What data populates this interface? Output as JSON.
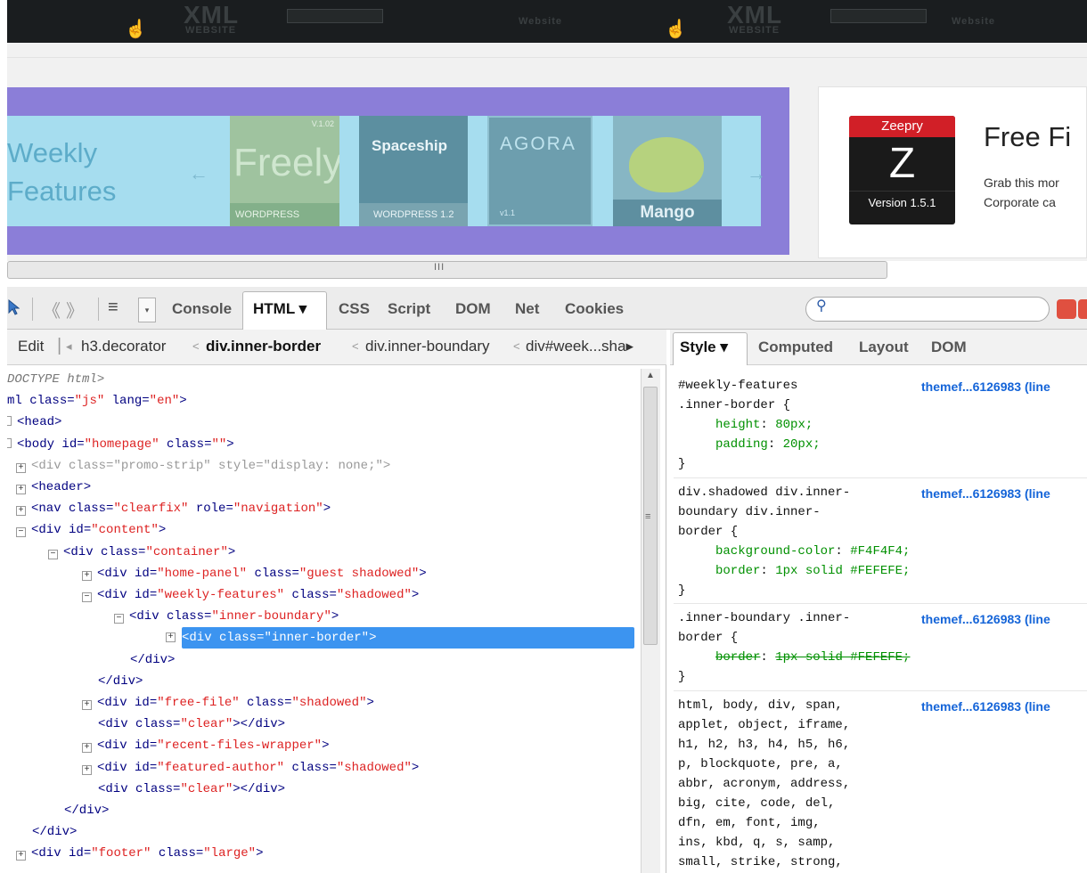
{
  "banner": {
    "items": [
      "XML",
      "WEBSITE",
      "XML",
      "WEBSITE"
    ],
    "small": [
      "Website",
      "Website"
    ]
  },
  "weekly": {
    "title_line1": "Weekly",
    "title_line2": "Features",
    "themes": [
      {
        "name": "Freely",
        "version": "V.1.02",
        "label": "WORDPRESS"
      },
      {
        "name": "Spaceship",
        "label": "WORDPRESS 1.2"
      },
      {
        "name": "AGORA",
        "label": "v1.1"
      },
      {
        "name": "Mango",
        "label": "Mango"
      }
    ]
  },
  "free_file": {
    "brand": "Zeepry",
    "logo_letter": "Z",
    "version": "Version 1.5.1",
    "title": "Free Fi",
    "desc_line1": "Grab this mor",
    "desc_line2": "Corporate ca"
  },
  "scrollbar": {
    "grip": "III"
  },
  "toolbar": {
    "tabs": [
      "Console",
      "HTML ▾",
      "CSS",
      "Script",
      "DOM",
      "Net",
      "Cookies"
    ],
    "search_placeholder": ""
  },
  "breadcrumb": {
    "edit": "Edit",
    "items": [
      "h3.decorator",
      "div.inner-border",
      "div.inner-boundary",
      "div#week...sha▸"
    ]
  },
  "dom_tree": [
    {
      "indent": 0,
      "exp": "",
      "text": "DOCTYPE html>",
      "kind": "doctype"
    },
    {
      "indent": 0,
      "exp": "",
      "pre": "ml ",
      "attr": "class=",
      "val": "\"js\"",
      "post": " lang=",
      "val2": "\"en\"",
      "end": ">",
      "kind": "html"
    },
    {
      "indent": 0,
      "exp": "-",
      "tag": "<head>",
      "kind": "tag"
    },
    {
      "indent": 0,
      "exp": "-",
      "tag": "<body ",
      "attr": "id=",
      "val": "\"homepage\"",
      "post": " class=",
      "val2": "\"\"",
      "end": ">",
      "kind": "attr"
    },
    {
      "indent": 1,
      "exp": "+",
      "tag": "<div ",
      "attr": "class=",
      "val": "\"promo-strip\"",
      "post": " style=",
      "val2": "\"display: none;\"",
      "end": ">",
      "kind": "attr",
      "dim": true
    },
    {
      "indent": 1,
      "exp": "+",
      "tag": "<header>",
      "kind": "tag"
    },
    {
      "indent": 1,
      "exp": "+",
      "tag": "<nav ",
      "attr": "class=",
      "val": "\"clearfix\"",
      "post": " role=",
      "val2": "\"navigation\"",
      "end": ">",
      "kind": "attr"
    },
    {
      "indent": 1,
      "exp": "-",
      "tag": "<div ",
      "attr": "id=",
      "val": "\"content\"",
      "end": ">",
      "kind": "attr"
    },
    {
      "indent": 2,
      "exp": "-",
      "tag": "<div ",
      "attr": "class=",
      "val": "\"container\"",
      "end": ">",
      "kind": "attr"
    },
    {
      "indent": 3,
      "exp": "+",
      "tag": "<div ",
      "attr": "id=",
      "val": "\"home-panel\"",
      "post": " class=",
      "val2": "\"guest shadowed\"",
      "end": ">",
      "kind": "attr"
    },
    {
      "indent": 3,
      "exp": "-",
      "tag": "<div ",
      "attr": "id=",
      "val": "\"weekly-features\"",
      "post": " class=",
      "val2": "\"shadowed\"",
      "end": ">",
      "kind": "attr"
    },
    {
      "indent": 4,
      "exp": "-",
      "tag": "<div ",
      "attr": "class=",
      "val": "\"inner-boundary\"",
      "end": ">",
      "kind": "attr"
    },
    {
      "indent": 5,
      "exp": "+",
      "tag": "<div ",
      "attr": "class=",
      "val": "\"inner-border\"",
      "end": ">",
      "kind": "attr",
      "selected": true
    },
    {
      "indent": 4,
      "exp": "",
      "tag": "</div>",
      "kind": "tag",
      "pad": true
    },
    {
      "indent": 3,
      "exp": "",
      "tag": "</div>",
      "kind": "tag",
      "pad": true
    },
    {
      "indent": 3,
      "exp": "+",
      "tag": "<div ",
      "attr": "id=",
      "val": "\"free-file\"",
      "post": " class=",
      "val2": "\"shadowed\"",
      "end": ">",
      "kind": "attr"
    },
    {
      "indent": 3,
      "exp": "",
      "tag": "<div ",
      "attr": "class=",
      "val": "\"clear\"",
      "end": "></div>",
      "kind": "attr",
      "pad": true
    },
    {
      "indent": 3,
      "exp": "+",
      "tag": "<div ",
      "attr": "id=",
      "val": "\"recent-files-wrapper\"",
      "end": ">",
      "kind": "attr"
    },
    {
      "indent": 3,
      "exp": "+",
      "tag": "<div ",
      "attr": "id=",
      "val": "\"featured-author\"",
      "post": " class=",
      "val2": "\"shadowed\"",
      "end": ">",
      "kind": "attr"
    },
    {
      "indent": 3,
      "exp": "",
      "tag": "<div ",
      "attr": "class=",
      "val": "\"clear\"",
      "end": "></div>",
      "kind": "attr",
      "pad": true
    },
    {
      "indent": 2,
      "exp": "",
      "tag": "</div>",
      "kind": "tag",
      "pad": true
    },
    {
      "indent": 1,
      "exp": "",
      "tag": "</div>",
      "kind": "tag",
      "pad": true
    },
    {
      "indent": 1,
      "exp": "+",
      "tag": "<div ",
      "attr": "id=",
      "val": "\"footer\"",
      "post": " class=",
      "val2": "\"large\"",
      "end": ">",
      "kind": "attr"
    }
  ],
  "style_tabs": [
    "Style ▾",
    "Computed",
    "Layout",
    "DOM"
  ],
  "css_rules": [
    {
      "selector": [
        "#weekly-features",
        ".inner-border {"
      ],
      "props": [
        [
          "height",
          "80px;"
        ],
        [
          "padding",
          "20px;"
        ]
      ],
      "struck": false,
      "source": "themef...6126983 (line"
    },
    {
      "selector": [
        "div.shadowed div.inner-",
        "boundary div.inner-",
        "border {"
      ],
      "props": [
        [
          "background-color",
          "#F4F4F4;"
        ],
        [
          "border",
          "1px solid #FEFEFE;"
        ]
      ],
      "struck": false,
      "source": "themef...6126983 (line"
    },
    {
      "selector": [
        ".inner-boundary .inner-",
        "border {"
      ],
      "props": [
        [
          "border",
          "1px solid #FEFEFE;"
        ]
      ],
      "struck": true,
      "source": "themef...6126983 (line"
    },
    {
      "selector": [
        "html, body, div, span,",
        "applet, object, iframe,",
        "h1, h2, h3, h4, h5, h6,",
        "p, blockquote, pre, a,",
        "abbr, acronym, address,",
        "big, cite, code, del,",
        "dfn, em, font, img,",
        "ins, kbd, q, s, samp,",
        "small, strike, strong,"
      ],
      "props": [],
      "struck": false,
      "source": "themef...6126983 (line"
    }
  ],
  "close_brace": "}",
  "colors": {
    "accent": "#8b7ed8",
    "selection": "#3c94f0",
    "link": "#1464d8"
  }
}
